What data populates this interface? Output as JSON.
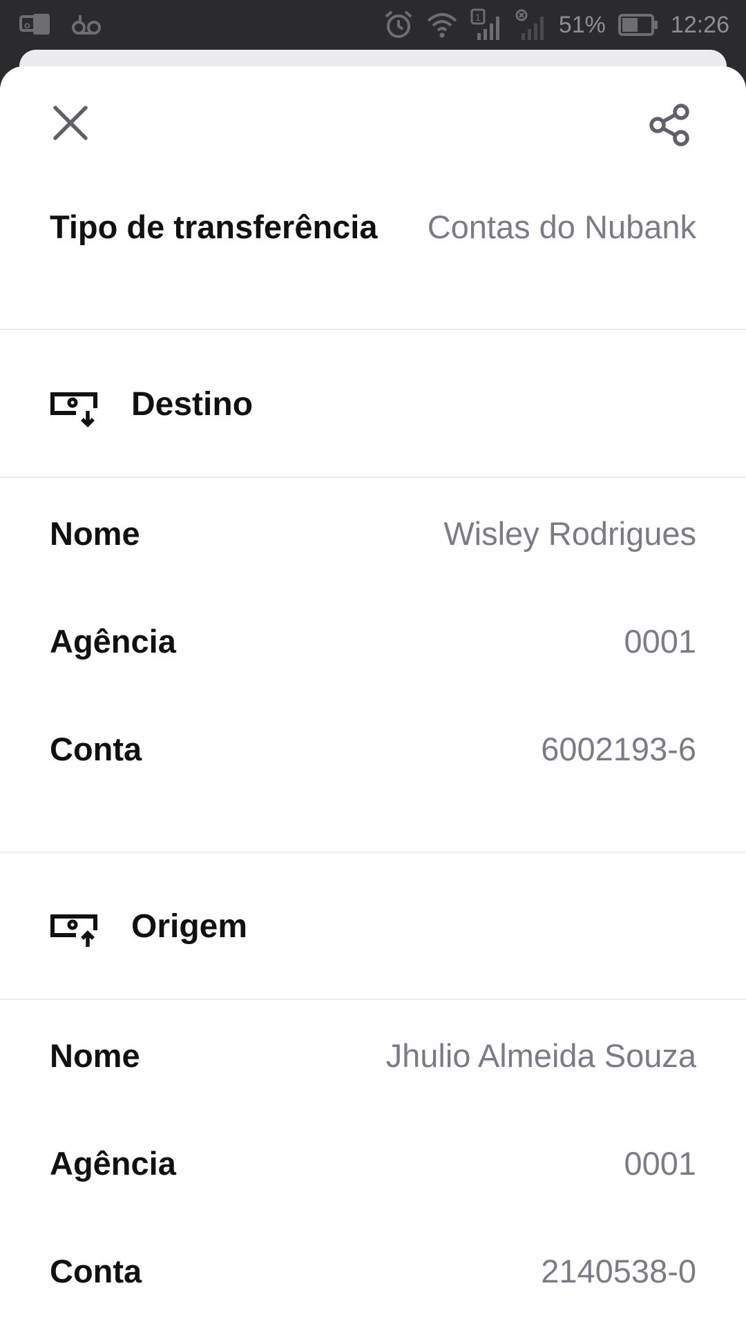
{
  "status_bar": {
    "battery_percent": "51%",
    "time": "12:26",
    "sim_badge": "1"
  },
  "header": {
    "close_icon": "close-icon",
    "share_icon": "share-icon"
  },
  "transfer": {
    "type_label": "Tipo de transferência",
    "type_value": "Contas do Nubank"
  },
  "destination": {
    "title": "Destino",
    "icon": "bank-account-in-icon",
    "name_label": "Nome",
    "name_value": "Wisley Rodrigues",
    "agency_label": "Agência",
    "agency_value": "0001",
    "account_label": "Conta",
    "account_value": "6002193-6"
  },
  "origin": {
    "title": "Origem",
    "icon": "bank-account-out-icon",
    "name_label": "Nome",
    "name_value": "Jhulio Almeida Souza",
    "agency_label": "Agência",
    "agency_value": "0001",
    "account_label": "Conta",
    "account_value": "2140538-0"
  },
  "colors": {
    "label": "#111114",
    "value": "#7a7b85",
    "icon": "#5f6068",
    "status_bar_bg": "#2b2b2d"
  }
}
